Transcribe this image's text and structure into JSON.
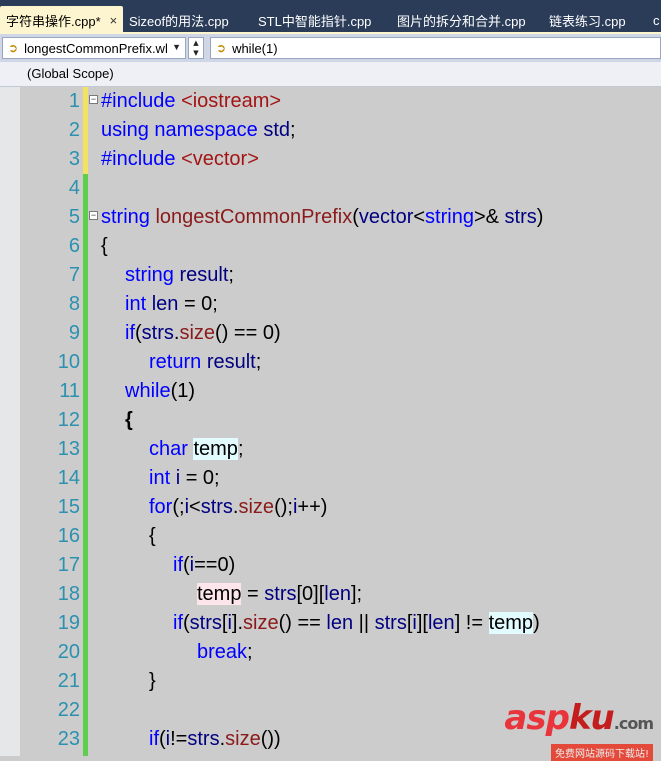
{
  "tabs": [
    {
      "label": "字符串操作.cpp*",
      "active": true,
      "close": "×"
    },
    {
      "label": "Sizeof的用法.cpp",
      "active": false
    },
    {
      "label": "STL中智能指针.cpp",
      "active": false
    },
    {
      "label": "图片的拆分和合并.cpp",
      "active": false
    },
    {
      "label": "链表练习.cpp",
      "active": false
    },
    {
      "label": "c",
      "active": false
    }
  ],
  "navbar": {
    "file_combo": "longestCommonPrefix.wl",
    "member_combo": "while(1)",
    "scope": "(Global Scope)"
  },
  "colors": {
    "tab_background": "#2b3c59",
    "active_tab": "#fdf5cf",
    "editor_background": "#cccccc",
    "line_number": "#2b91af",
    "keyword": "#0000ff",
    "change_green": "#5fcd4e",
    "change_yellow": "#f4e263"
  },
  "code": {
    "lines": [
      {
        "n": "1",
        "indent": 0,
        "outline": "−",
        "tokens": [
          [
            "pp",
            "#include "
          ],
          [
            "inc",
            "<iostream>"
          ]
        ]
      },
      {
        "n": "2",
        "indent": 0,
        "tokens": [
          [
            "kw",
            "using"
          ],
          [
            "pl",
            " "
          ],
          [
            "kw",
            "namespace"
          ],
          [
            "pl",
            " "
          ],
          [
            "id",
            "std"
          ],
          [
            "pl",
            ";"
          ]
        ]
      },
      {
        "n": "3",
        "indent": 0,
        "tokens": [
          [
            "pp",
            "#include "
          ],
          [
            "inc",
            "<vector>"
          ]
        ]
      },
      {
        "n": "4",
        "indent": 0,
        "tokens": []
      },
      {
        "n": "5",
        "indent": 0,
        "outline": "−",
        "tokens": [
          [
            "kw",
            "string"
          ],
          [
            "pl",
            " "
          ],
          [
            "fn",
            "longestCommonPrefix"
          ],
          [
            "pl",
            "("
          ],
          [
            "id",
            "vector"
          ],
          [
            "pl",
            "<"
          ],
          [
            "kw",
            "string"
          ],
          [
            "pl",
            ">& "
          ],
          [
            "id",
            "strs"
          ],
          [
            "pl",
            ")"
          ]
        ]
      },
      {
        "n": "6",
        "indent": 0,
        "tokens": [
          [
            "pl",
            "{"
          ]
        ]
      },
      {
        "n": "7",
        "indent": 1,
        "tokens": [
          [
            "kw",
            "string"
          ],
          [
            "pl",
            " "
          ],
          [
            "id",
            "result"
          ],
          [
            "pl",
            ";"
          ]
        ]
      },
      {
        "n": "8",
        "indent": 1,
        "tokens": [
          [
            "kw",
            "int"
          ],
          [
            "pl",
            " "
          ],
          [
            "id",
            "len"
          ],
          [
            "pl",
            " = 0;"
          ]
        ]
      },
      {
        "n": "9",
        "indent": 1,
        "tokens": [
          [
            "kw",
            "if"
          ],
          [
            "pl",
            "("
          ],
          [
            "id",
            "strs"
          ],
          [
            "pl",
            "."
          ],
          [
            "fn",
            "size"
          ],
          [
            "pl",
            "() == 0)"
          ]
        ]
      },
      {
        "n": "10",
        "indent": 2,
        "tokens": [
          [
            "kw",
            "return"
          ],
          [
            "pl",
            " "
          ],
          [
            "id",
            "result"
          ],
          [
            "pl",
            ";"
          ]
        ]
      },
      {
        "n": "11",
        "indent": 1,
        "tokens": [
          [
            "kw",
            "while"
          ],
          [
            "pl",
            "(1)"
          ]
        ]
      },
      {
        "n": "12",
        "indent": 1,
        "tokens": [
          [
            "bold",
            "{"
          ]
        ]
      },
      {
        "n": "13",
        "indent": 2,
        "tokens": [
          [
            "kw",
            "char"
          ],
          [
            "pl",
            " "
          ],
          [
            "cyan",
            "temp"
          ],
          [
            "pl",
            ";"
          ]
        ]
      },
      {
        "n": "14",
        "indent": 2,
        "tokens": [
          [
            "kw",
            "int"
          ],
          [
            "pl",
            " "
          ],
          [
            "id",
            "i"
          ],
          [
            "pl",
            " = 0;"
          ]
        ]
      },
      {
        "n": "15",
        "indent": 2,
        "tokens": [
          [
            "kw",
            "for"
          ],
          [
            "pl",
            "(;"
          ],
          [
            "id",
            "i"
          ],
          [
            "pl",
            "<"
          ],
          [
            "id",
            "strs"
          ],
          [
            "pl",
            "."
          ],
          [
            "fn",
            "size"
          ],
          [
            "pl",
            "();"
          ],
          [
            "id",
            "i"
          ],
          [
            "pl",
            "++)"
          ]
        ]
      },
      {
        "n": "16",
        "indent": 2,
        "tokens": [
          [
            "pl",
            "{"
          ]
        ]
      },
      {
        "n": "17",
        "indent": 3,
        "tokens": [
          [
            "kw",
            "if"
          ],
          [
            "pl",
            "("
          ],
          [
            "id",
            "i"
          ],
          [
            "pl",
            "==0)"
          ]
        ]
      },
      {
        "n": "18",
        "indent": 4,
        "tokens": [
          [
            "pink",
            "temp"
          ],
          [
            "pl",
            " = "
          ],
          [
            "id",
            "strs"
          ],
          [
            "pl",
            "[0]["
          ],
          [
            "id",
            "len"
          ],
          [
            "pl",
            "];"
          ]
        ]
      },
      {
        "n": "19",
        "indent": 3,
        "tokens": [
          [
            "kw",
            "if"
          ],
          [
            "pl",
            "("
          ],
          [
            "id",
            "strs"
          ],
          [
            "pl",
            "["
          ],
          [
            "id",
            "i"
          ],
          [
            "pl",
            "]."
          ],
          [
            "fn",
            "size"
          ],
          [
            "pl",
            "() == "
          ],
          [
            "id",
            "len"
          ],
          [
            "pl",
            " || "
          ],
          [
            "id",
            "strs"
          ],
          [
            "pl",
            "["
          ],
          [
            "id",
            "i"
          ],
          [
            "pl",
            "]["
          ],
          [
            "id",
            "len"
          ],
          [
            "pl",
            "] != "
          ],
          [
            "cyan",
            "temp"
          ],
          [
            "pl",
            ")"
          ]
        ]
      },
      {
        "n": "20",
        "indent": 4,
        "tokens": [
          [
            "kw",
            "break"
          ],
          [
            "pl",
            ";"
          ]
        ]
      },
      {
        "n": "21",
        "indent": 2,
        "tokens": [
          [
            "pl",
            "}"
          ]
        ]
      },
      {
        "n": "22",
        "indent": 0,
        "tokens": []
      },
      {
        "n": "23",
        "indent": 2,
        "tokens": [
          [
            "kw",
            "if"
          ],
          [
            "pl",
            "("
          ],
          [
            "id",
            "i"
          ],
          [
            "pl",
            "!="
          ],
          [
            "id",
            "strs"
          ],
          [
            "pl",
            "."
          ],
          [
            "fn",
            "size"
          ],
          [
            "pl",
            "())"
          ]
        ]
      }
    ]
  },
  "watermark": {
    "logo_a": "asp",
    "logo_b": "ku",
    "logo_suffix": ".com",
    "subtitle": "免费网站源码下载站!"
  }
}
